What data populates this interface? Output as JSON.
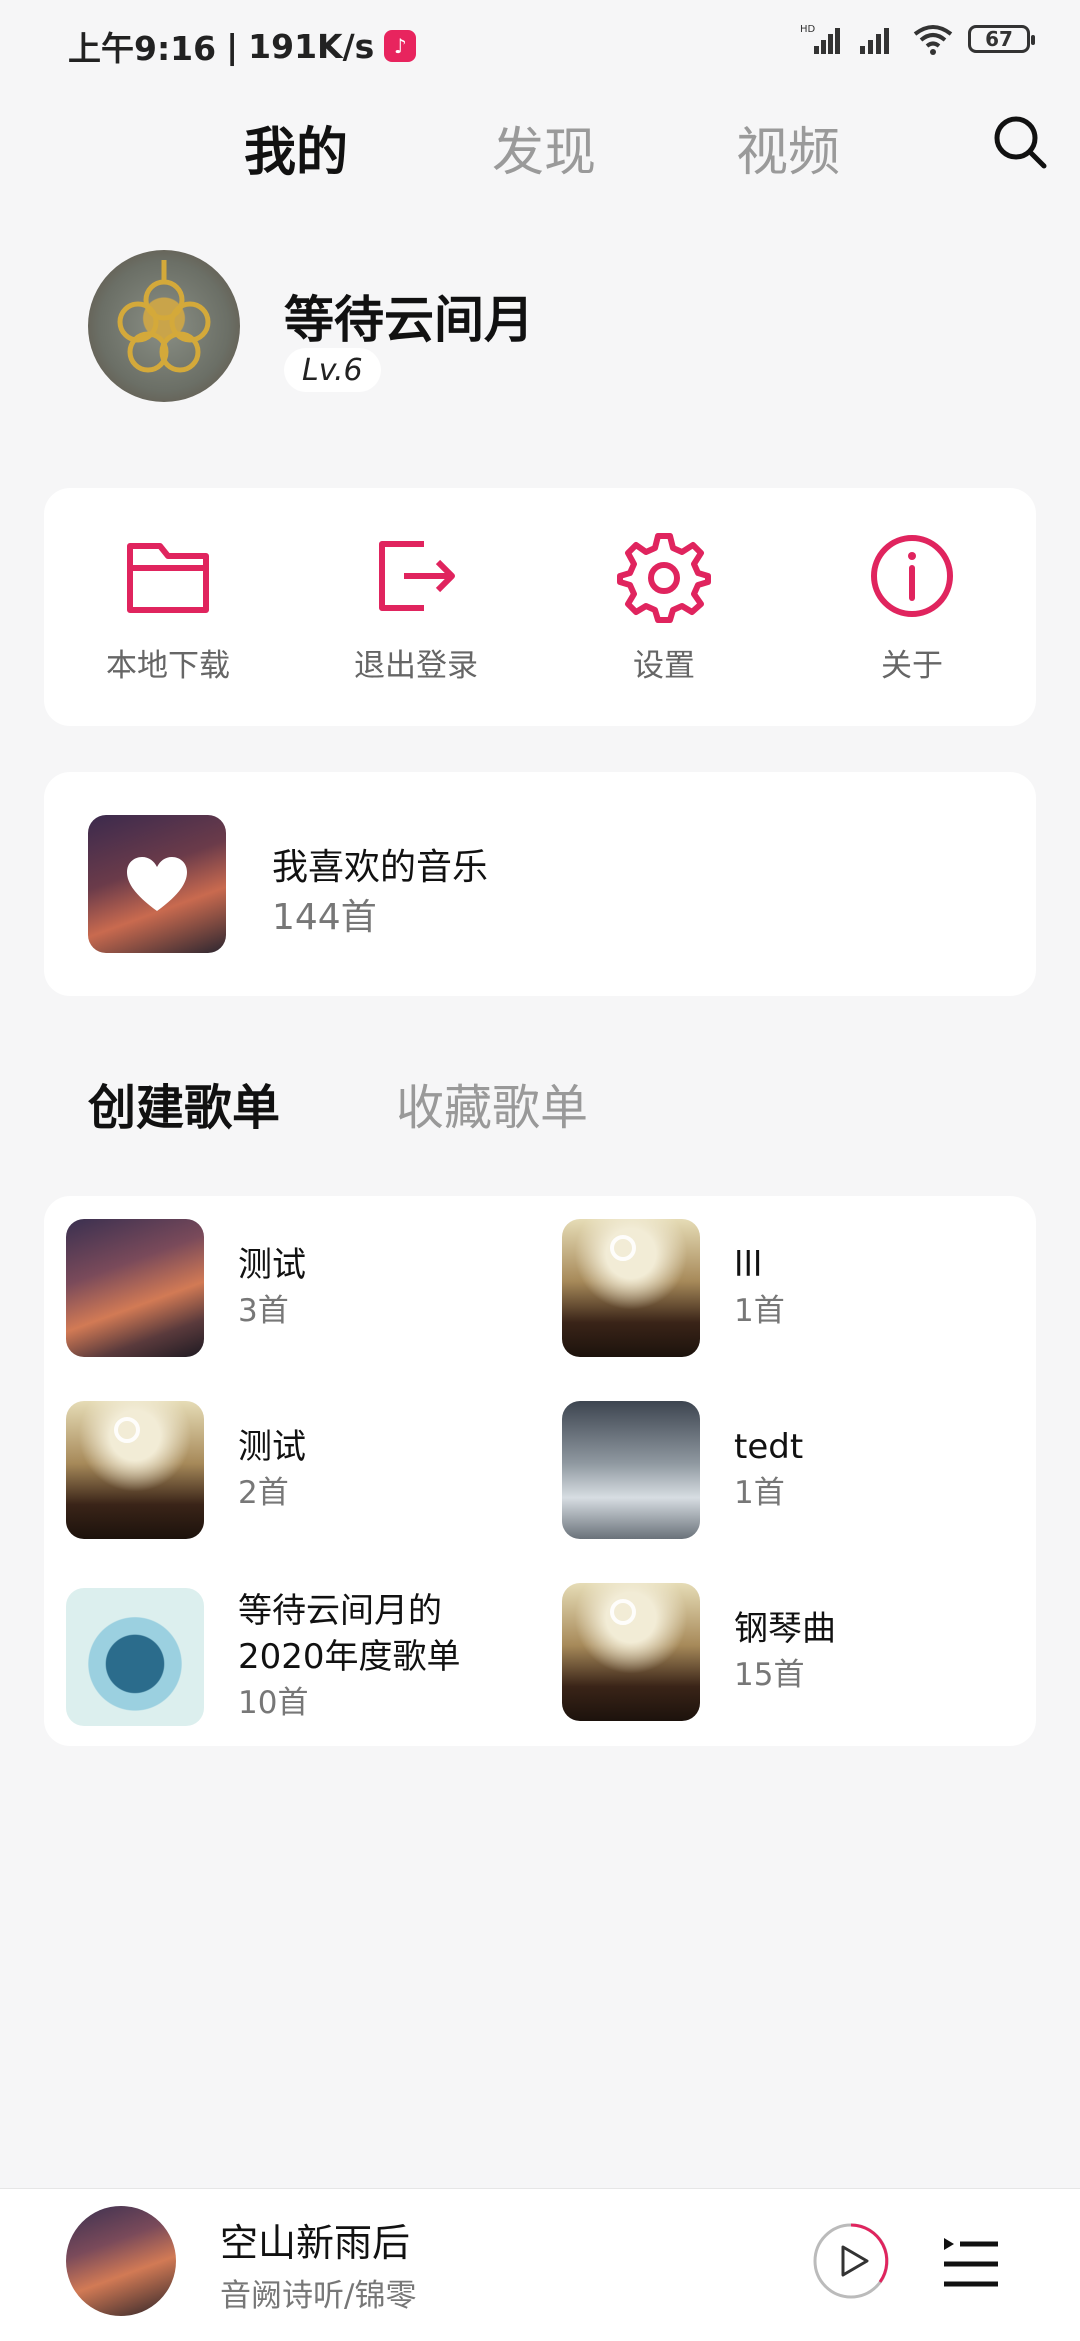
{
  "status_bar": {
    "time": "上午9:16",
    "speed": "191K/s",
    "network_label": "HD",
    "battery": "67"
  },
  "tabs": [
    {
      "label": "我的",
      "active": true
    },
    {
      "label": "发现",
      "active": false
    },
    {
      "label": "视频",
      "active": false
    }
  ],
  "profile": {
    "username": "等待云间月",
    "level": "Lv.6"
  },
  "actions": [
    {
      "label": "本地下载",
      "icon": "folder-icon"
    },
    {
      "label": "退出登录",
      "icon": "logout-icon"
    },
    {
      "label": "设置",
      "icon": "gear-icon"
    },
    {
      "label": "关于",
      "icon": "info-icon"
    }
  ],
  "favorites": {
    "title": "我喜欢的音乐",
    "count": "144首"
  },
  "section_tabs": [
    {
      "label": "创建歌单",
      "active": true
    },
    {
      "label": "收藏歌单",
      "active": false
    }
  ],
  "playlists": [
    {
      "name": "测试",
      "count": "3首",
      "cover": "sunset"
    },
    {
      "name": "lll",
      "count": "1首",
      "cover": "crowd"
    },
    {
      "name": "测试",
      "count": "2首",
      "cover": "crowd"
    },
    {
      "name": "tedt",
      "count": "1首",
      "cover": "ship"
    },
    {
      "name_line1": "等待云间月的",
      "name_line2": "2020年度歌单",
      "count": "10首",
      "cover": "disc"
    },
    {
      "name": "钢琴曲",
      "count": "15首",
      "cover": "crowd"
    }
  ],
  "player": {
    "title": "空山新雨后",
    "artist": "音阙诗听/锦零"
  },
  "colors": {
    "accent": "#e0245e",
    "background": "#f6f6f7",
    "card": "#ffffff",
    "muted_text": "#777777"
  }
}
